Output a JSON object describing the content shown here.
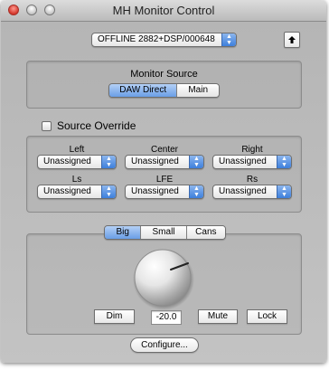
{
  "window": {
    "title": "MH Monitor Control"
  },
  "device_popup": {
    "value": "OFFLINE 2882+DSP/000648"
  },
  "eject_button": {
    "icon": "up-arrow-icon"
  },
  "monitor_source": {
    "label": "Monitor Source",
    "options": [
      "DAW Direct",
      "Main"
    ],
    "selected": "DAW Direct"
  },
  "source_override": {
    "label": "Source Override",
    "checked": false
  },
  "channels": [
    {
      "name": "Left",
      "value": "Unassigned"
    },
    {
      "name": "Center",
      "value": "Unassigned"
    },
    {
      "name": "Right",
      "value": "Unassigned"
    },
    {
      "name": "Ls",
      "value": "Unassigned"
    },
    {
      "name": "LFE",
      "value": "Unassigned"
    },
    {
      "name": "Rs",
      "value": "Unassigned"
    }
  ],
  "speaker_set": {
    "options": [
      "Big",
      "Small",
      "Cans"
    ],
    "selected": "Big"
  },
  "volume": {
    "value": "-20.0"
  },
  "buttons": {
    "dim": "Dim",
    "mute": "Mute",
    "lock": "Lock"
  },
  "configure_button": {
    "label": "Configure..."
  }
}
